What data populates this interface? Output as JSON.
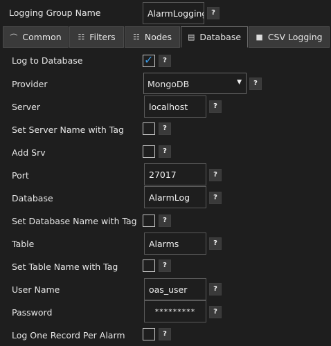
{
  "group": {
    "label": "Logging Group Name",
    "value": "AlarmLogging",
    "help": "?"
  },
  "tabs": [
    {
      "label": "Common",
      "icon": "⌒"
    },
    {
      "label": "Filters",
      "icon": "☷"
    },
    {
      "label": "Nodes",
      "icon": "☷"
    },
    {
      "label": "Database",
      "icon": "▤"
    },
    {
      "label": "CSV Logging",
      "icon": "■"
    }
  ],
  "active_tab": "Database",
  "fields": {
    "log_to_database": {
      "label": "Log to Database",
      "checked": true
    },
    "provider": {
      "label": "Provider",
      "value": "MongoDB"
    },
    "server": {
      "label": "Server",
      "value": "localhost"
    },
    "set_server_name_with_tag": {
      "label": "Set Server Name with Tag",
      "checked": false
    },
    "add_srv": {
      "label": "Add Srv",
      "checked": false
    },
    "port": {
      "label": "Port",
      "value": "27017"
    },
    "database": {
      "label": "Database",
      "value": "AlarmLog"
    },
    "set_database_name_with_tag": {
      "label": "Set Database Name with Tag",
      "checked": false
    },
    "table": {
      "label": "Table",
      "value": "Alarms"
    },
    "set_table_name_with_tag": {
      "label": "Set Table Name with Tag",
      "checked": false
    },
    "user_name": {
      "label": "User Name",
      "value": "oas_user"
    },
    "password": {
      "label": "Password",
      "value": "*********"
    },
    "log_one_record_per_alarm": {
      "label": "Log One Record Per Alarm",
      "checked": false
    }
  },
  "help_label": "?",
  "colors": {
    "background": "#1e1e1e",
    "tab_inactive": "#3a3a3a",
    "check_accent": "#3a9ae6"
  }
}
